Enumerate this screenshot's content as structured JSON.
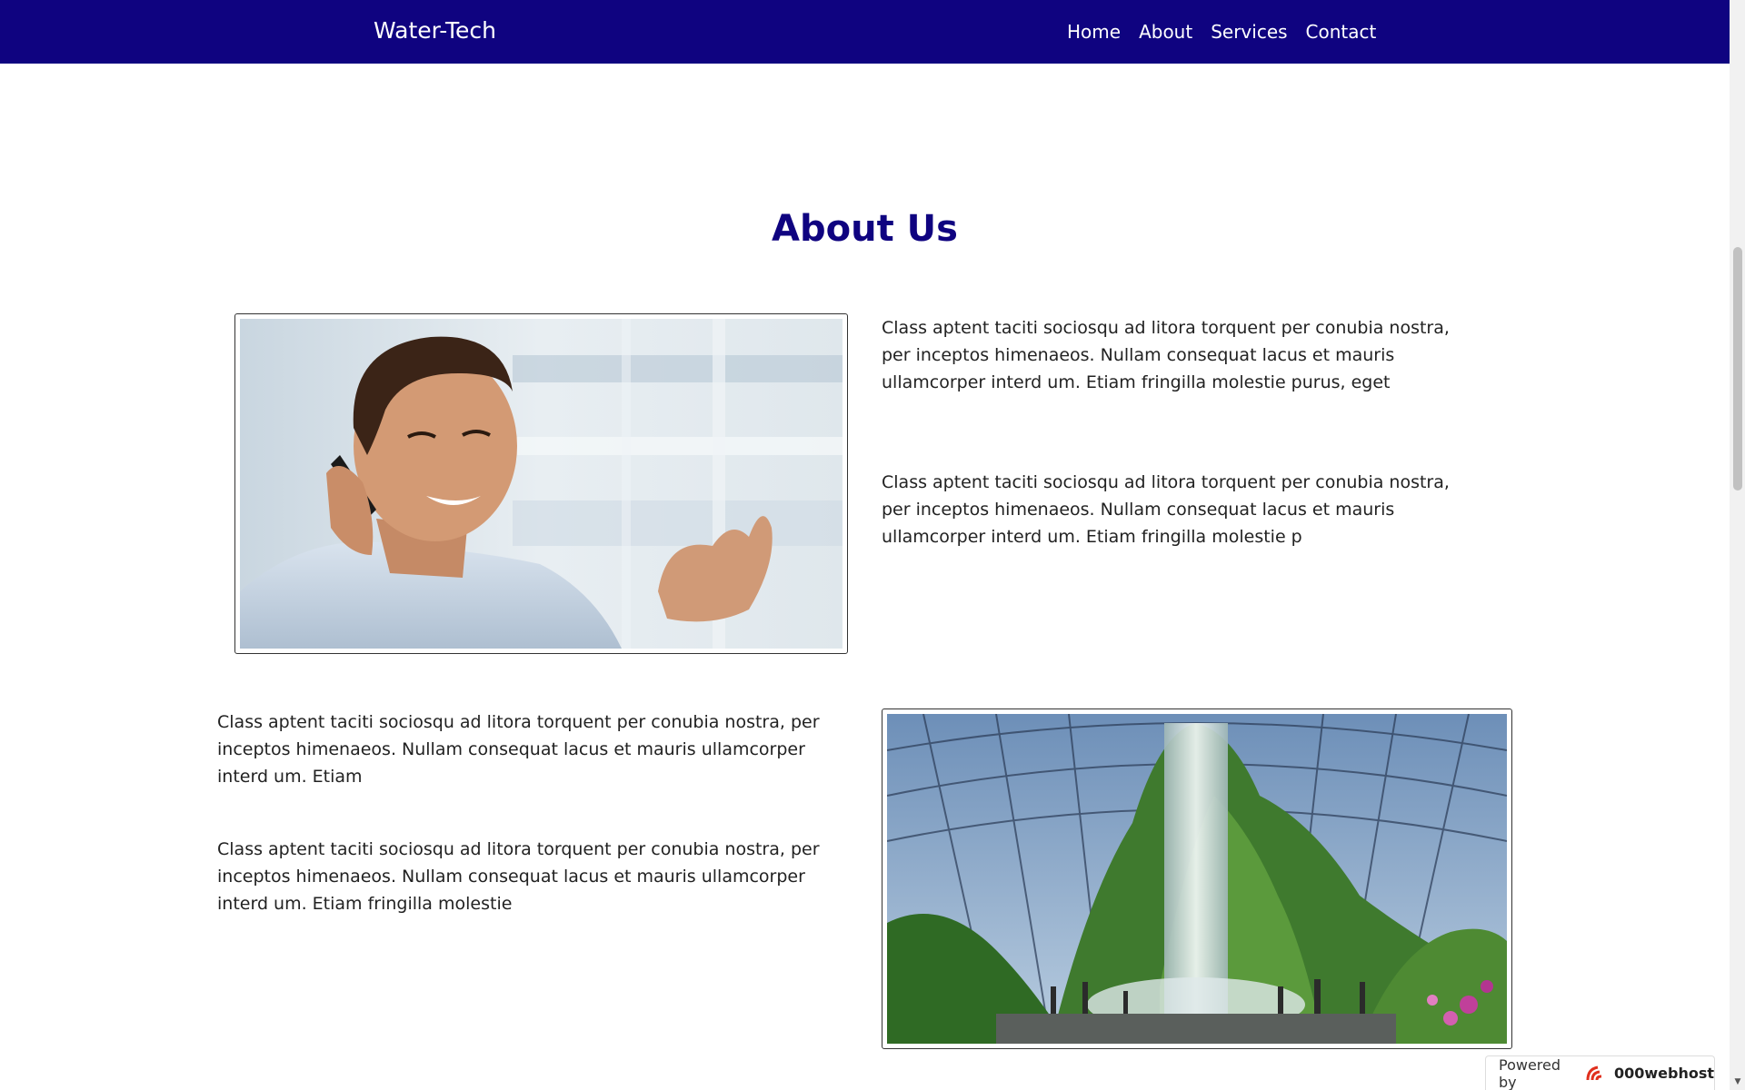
{
  "navbar": {
    "brand": "Water-Tech",
    "links": [
      {
        "label": "Home"
      },
      {
        "label": "About"
      },
      {
        "label": "Services"
      },
      {
        "label": "Contact"
      }
    ]
  },
  "about": {
    "title": "About Us",
    "paragraphs": [
      "Class aptent taciti sociosqu ad litora torquent per conubia nostra, per inceptos himenaeos. Nullam consequat lacus et mauris ullamcorper interd um. Etiam fringilla molestie purus, eget",
      "Class aptent taciti sociosqu ad litora torquent per conubia nostra, per inceptos himenaeos. Nullam consequat lacus et mauris ullamcorper interd um. Etiam fringilla molestie p",
      "Class aptent taciti sociosqu ad litora torquent per conubia nostra, per inceptos himenaeos. Nullam consequat lacus et mauris ullamcorper interd um. Etiam",
      "Class aptent taciti sociosqu ad litora torquent per conubia nostra, per inceptos himenaeos. Nullam consequat lacus et mauris ullamcorper interd um. Etiam fringilla molestie"
    ]
  },
  "badge": {
    "prefix": "Powered by",
    "host": "000webhost"
  },
  "colors": {
    "navbar": "#0f0380",
    "title": "#0f0380"
  }
}
